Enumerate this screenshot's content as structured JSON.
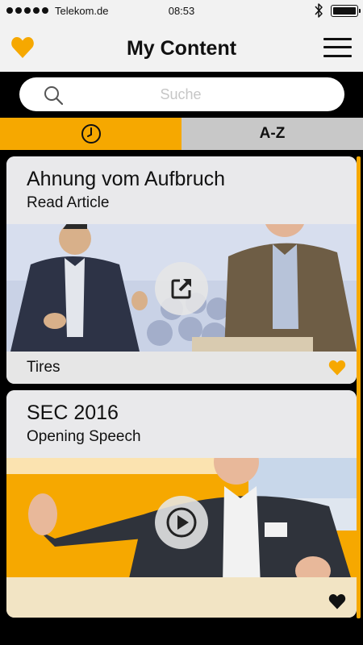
{
  "statusbar": {
    "carrier": "Telekom.de",
    "time": "08:53"
  },
  "header": {
    "title": "My Content"
  },
  "search": {
    "placeholder": "Suche"
  },
  "tabs": {
    "recent_icon": "clock-icon",
    "az_label": "A-Z",
    "active": "recent"
  },
  "colors": {
    "accent": "#f6a800",
    "header_bg": "#f2f2f2",
    "tab_inactive": "#c8c8c8"
  },
  "cards": [
    {
      "title": "Ahnung vom Aufbruch",
      "subtitle": "Read Article",
      "tag": "Tires",
      "action_icon": "external-link-icon",
      "favorite_icon": "heart-icon",
      "favorited_color": "#f6a800"
    },
    {
      "title": "SEC 2016",
      "subtitle": "Opening Speech",
      "tag": "",
      "action_icon": "play-icon",
      "favorite_icon": "heart-icon",
      "favorited_color": "#111111"
    }
  ]
}
